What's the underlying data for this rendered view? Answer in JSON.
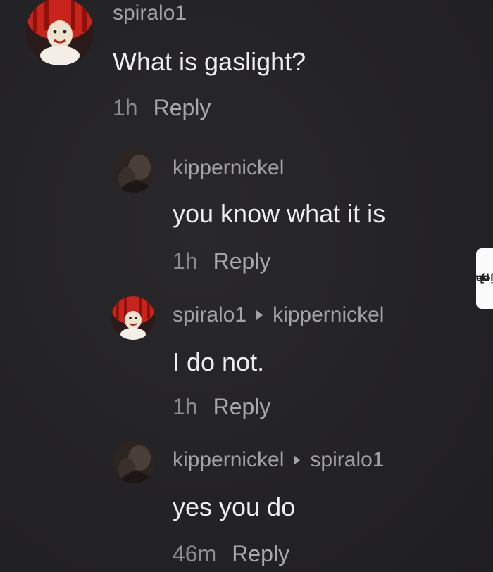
{
  "comments": [
    {
      "username": "spiralo1",
      "reply_to": "",
      "text": "What is gaslight?",
      "time": "1h",
      "reply_label": "Reply",
      "avatar_icon": "clown-avatar-icon"
    },
    {
      "username": "kippernickel",
      "reply_to": "",
      "text": "you know what it is",
      "time": "1h",
      "reply_label": "Reply",
      "avatar_icon": "dark-photo-avatar-icon"
    },
    {
      "username": "spiralo1",
      "reply_to": "kippernickel",
      "text": "I do not.",
      "time": "1h",
      "reply_label": "Reply",
      "avatar_icon": "clown-avatar-icon"
    },
    {
      "username": "kippernickel",
      "reply_to": "spiralo1",
      "text": "yes you do",
      "time": "46m",
      "reply_label": "Reply",
      "avatar_icon": "dark-photo-avatar-icon"
    }
  ],
  "watermark": {
    "name": "jeja",
    "dot": ".",
    "tld": "pl"
  },
  "colors": {
    "background": "#242326",
    "username": "#a3a2a7",
    "text": "#eeeef0",
    "time": "#8d8c91",
    "reply": "#a9a8ad",
    "watermark_bg": "#fbfbfb",
    "watermark_accent": "#e2191a"
  }
}
